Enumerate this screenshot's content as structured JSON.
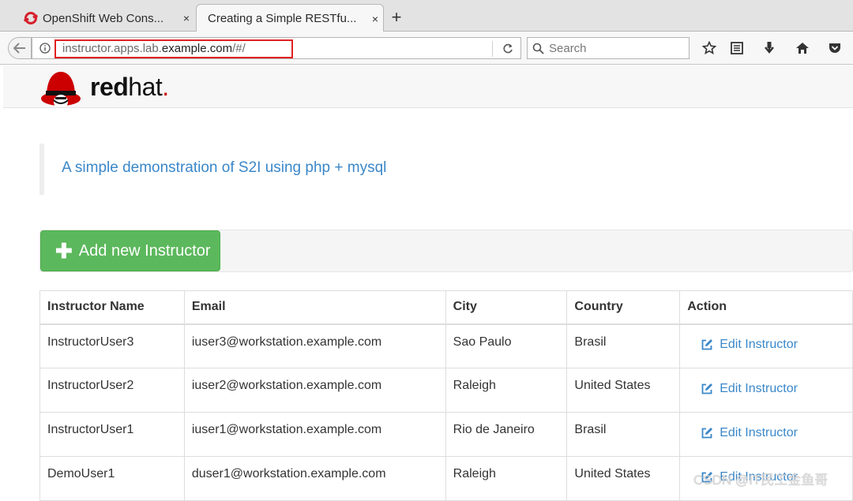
{
  "browser": {
    "tabs": [
      {
        "title": "OpenShift Web Cons...",
        "close": "×"
      },
      {
        "title": "Creating a Simple RESTfu...",
        "close": "×"
      }
    ],
    "new_tab": "+",
    "url_prefix": "instructor.apps.lab.",
    "url_domain": "example.com",
    "url_suffix": "/#/",
    "search_placeholder": "Search"
  },
  "page": {
    "logo_red": "red",
    "logo_hat": "hat",
    "logo_dot": ".",
    "intro": "A simple demonstration of S2I using php + mysql",
    "add_button": "Add new Instructor",
    "table": {
      "headers": [
        "Instructor Name",
        "Email",
        "City",
        "Country",
        "Action"
      ],
      "rows": [
        {
          "name": "InstructorUser3",
          "email": "iuser3@workstation.example.com",
          "city": "Sao Paulo",
          "country": "Brasil",
          "action": "Edit Instructor"
        },
        {
          "name": "InstructorUser2",
          "email": "iuser2@workstation.example.com",
          "city": "Raleigh",
          "country": "United States",
          "action": "Edit Instructor"
        },
        {
          "name": "InstructorUser1",
          "email": "iuser1@workstation.example.com",
          "city": "Rio de Janeiro",
          "country": "Brasil",
          "action": "Edit Instructor"
        },
        {
          "name": "DemoUser1",
          "email": "duser1@workstation.example.com",
          "city": "Raleigh",
          "country": "United States",
          "action": "Edit Instructor"
        }
      ]
    }
  },
  "watermark": "CSDN @IT民工金鱼哥",
  "colors": {
    "link": "#3a87c9",
    "success": "#5cb85c",
    "url_highlight": "#e02020",
    "brand_red": "#cc0000"
  }
}
